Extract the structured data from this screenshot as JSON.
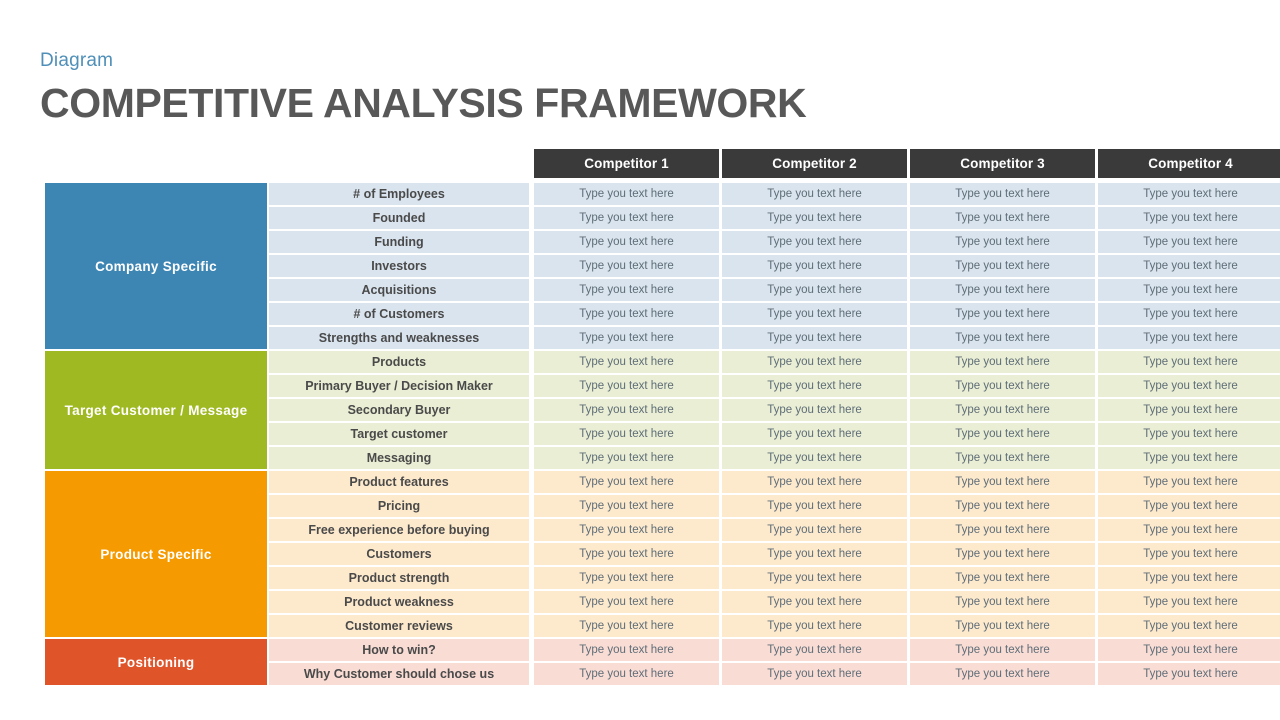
{
  "header": {
    "kicker": "Diagram",
    "title": "COMPETITIVE ANALYSIS FRAMEWORK"
  },
  "table": {
    "competitor_headers": [
      "Competitor 1",
      "Competitor 2",
      "Competitor 3",
      "Competitor 4"
    ],
    "cell_placeholder": "Type you text here",
    "colors": {
      "company_header": "#3d86b4",
      "company_body": "#d9e4ee",
      "target_header": "#9fb922",
      "target_body": "#e9eed4",
      "product_header": "#f59a00",
      "product_body": "#fdeacd",
      "positioning_header": "#e0542a",
      "positioning_body": "#f9ddd5",
      "column_header": "#3a3a3a",
      "title": "#585858",
      "kicker": "#4f8fb8"
    },
    "sections": [
      {
        "label": "Company Specific",
        "rows": [
          "# of Employees",
          "Founded",
          "Funding",
          "Investors",
          "Acquisitions",
          "# of Customers",
          "Strengths and weaknesses"
        ]
      },
      {
        "label": "Target Customer  /  Message",
        "rows": [
          "Products",
          "Primary Buyer / Decision Maker",
          "Secondary Buyer",
          "Target customer",
          "Messaging"
        ]
      },
      {
        "label": "Product Specific",
        "rows": [
          "Product features",
          "Pricing",
          "Free experience before buying",
          "Customers",
          "Product strength",
          "Product weakness",
          "Customer reviews"
        ]
      },
      {
        "label": "Positioning",
        "rows": [
          "How to win?",
          "Why Customer should  chose us"
        ]
      }
    ]
  }
}
